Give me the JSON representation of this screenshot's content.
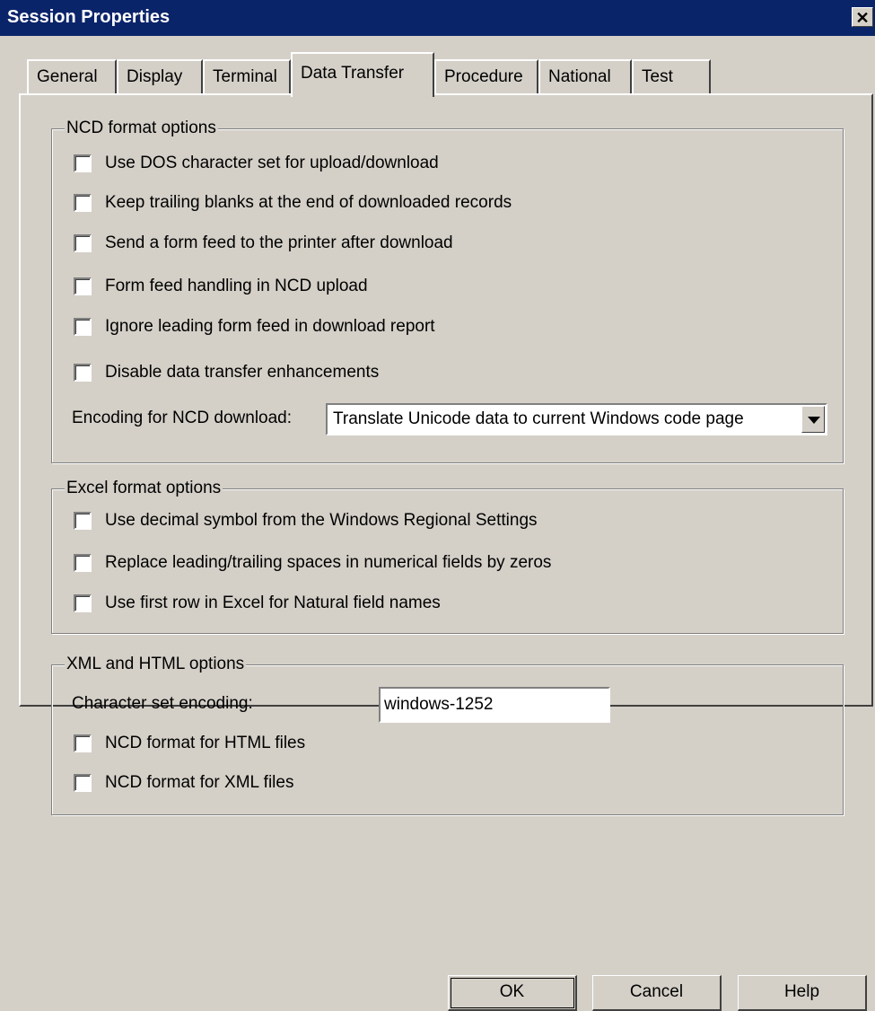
{
  "window": {
    "title": "Session Properties",
    "close_glyph": "✕"
  },
  "tabs": [
    {
      "label": "General",
      "active": false
    },
    {
      "label": "Display",
      "active": false
    },
    {
      "label": "Terminal",
      "active": false
    },
    {
      "label": "Data Transfer",
      "active": true
    },
    {
      "label": "Procedure",
      "active": false
    },
    {
      "label": "National",
      "active": false
    },
    {
      "label": "Test",
      "active": false
    }
  ],
  "ncd": {
    "group_label": "NCD format options",
    "options": [
      {
        "label": "Use DOS character set for upload/download",
        "checked": false
      },
      {
        "label": "Keep trailing blanks at the end of downloaded records",
        "checked": false
      },
      {
        "label": "Send a form feed to the printer after download",
        "checked": false
      },
      {
        "label": "Form feed handling in NCD upload",
        "checked": false
      },
      {
        "label": "Ignore leading form feed in download report",
        "checked": false
      },
      {
        "label": "Disable data transfer enhancements",
        "checked": false
      }
    ],
    "encoding_label": "Encoding for NCD download:",
    "encoding_value": "Translate Unicode data to current Windows code page"
  },
  "excel": {
    "group_label": "Excel format options",
    "options": [
      {
        "label": "Use decimal symbol from the Windows Regional Settings",
        "checked": false
      },
      {
        "label": "Replace leading/trailing spaces in numerical fields by zeros",
        "checked": false
      },
      {
        "label": "Use first row in Excel for Natural field names",
        "checked": false
      }
    ]
  },
  "xml": {
    "group_label": "XML and HTML options",
    "charset_label": "Character set encoding:",
    "charset_value": "windows-1252",
    "options": [
      {
        "label": "NCD format for HTML files",
        "checked": false
      },
      {
        "label": "NCD format for XML files",
        "checked": false
      }
    ]
  },
  "buttons": {
    "ok": "OK",
    "cancel": "Cancel",
    "help": "Help"
  }
}
